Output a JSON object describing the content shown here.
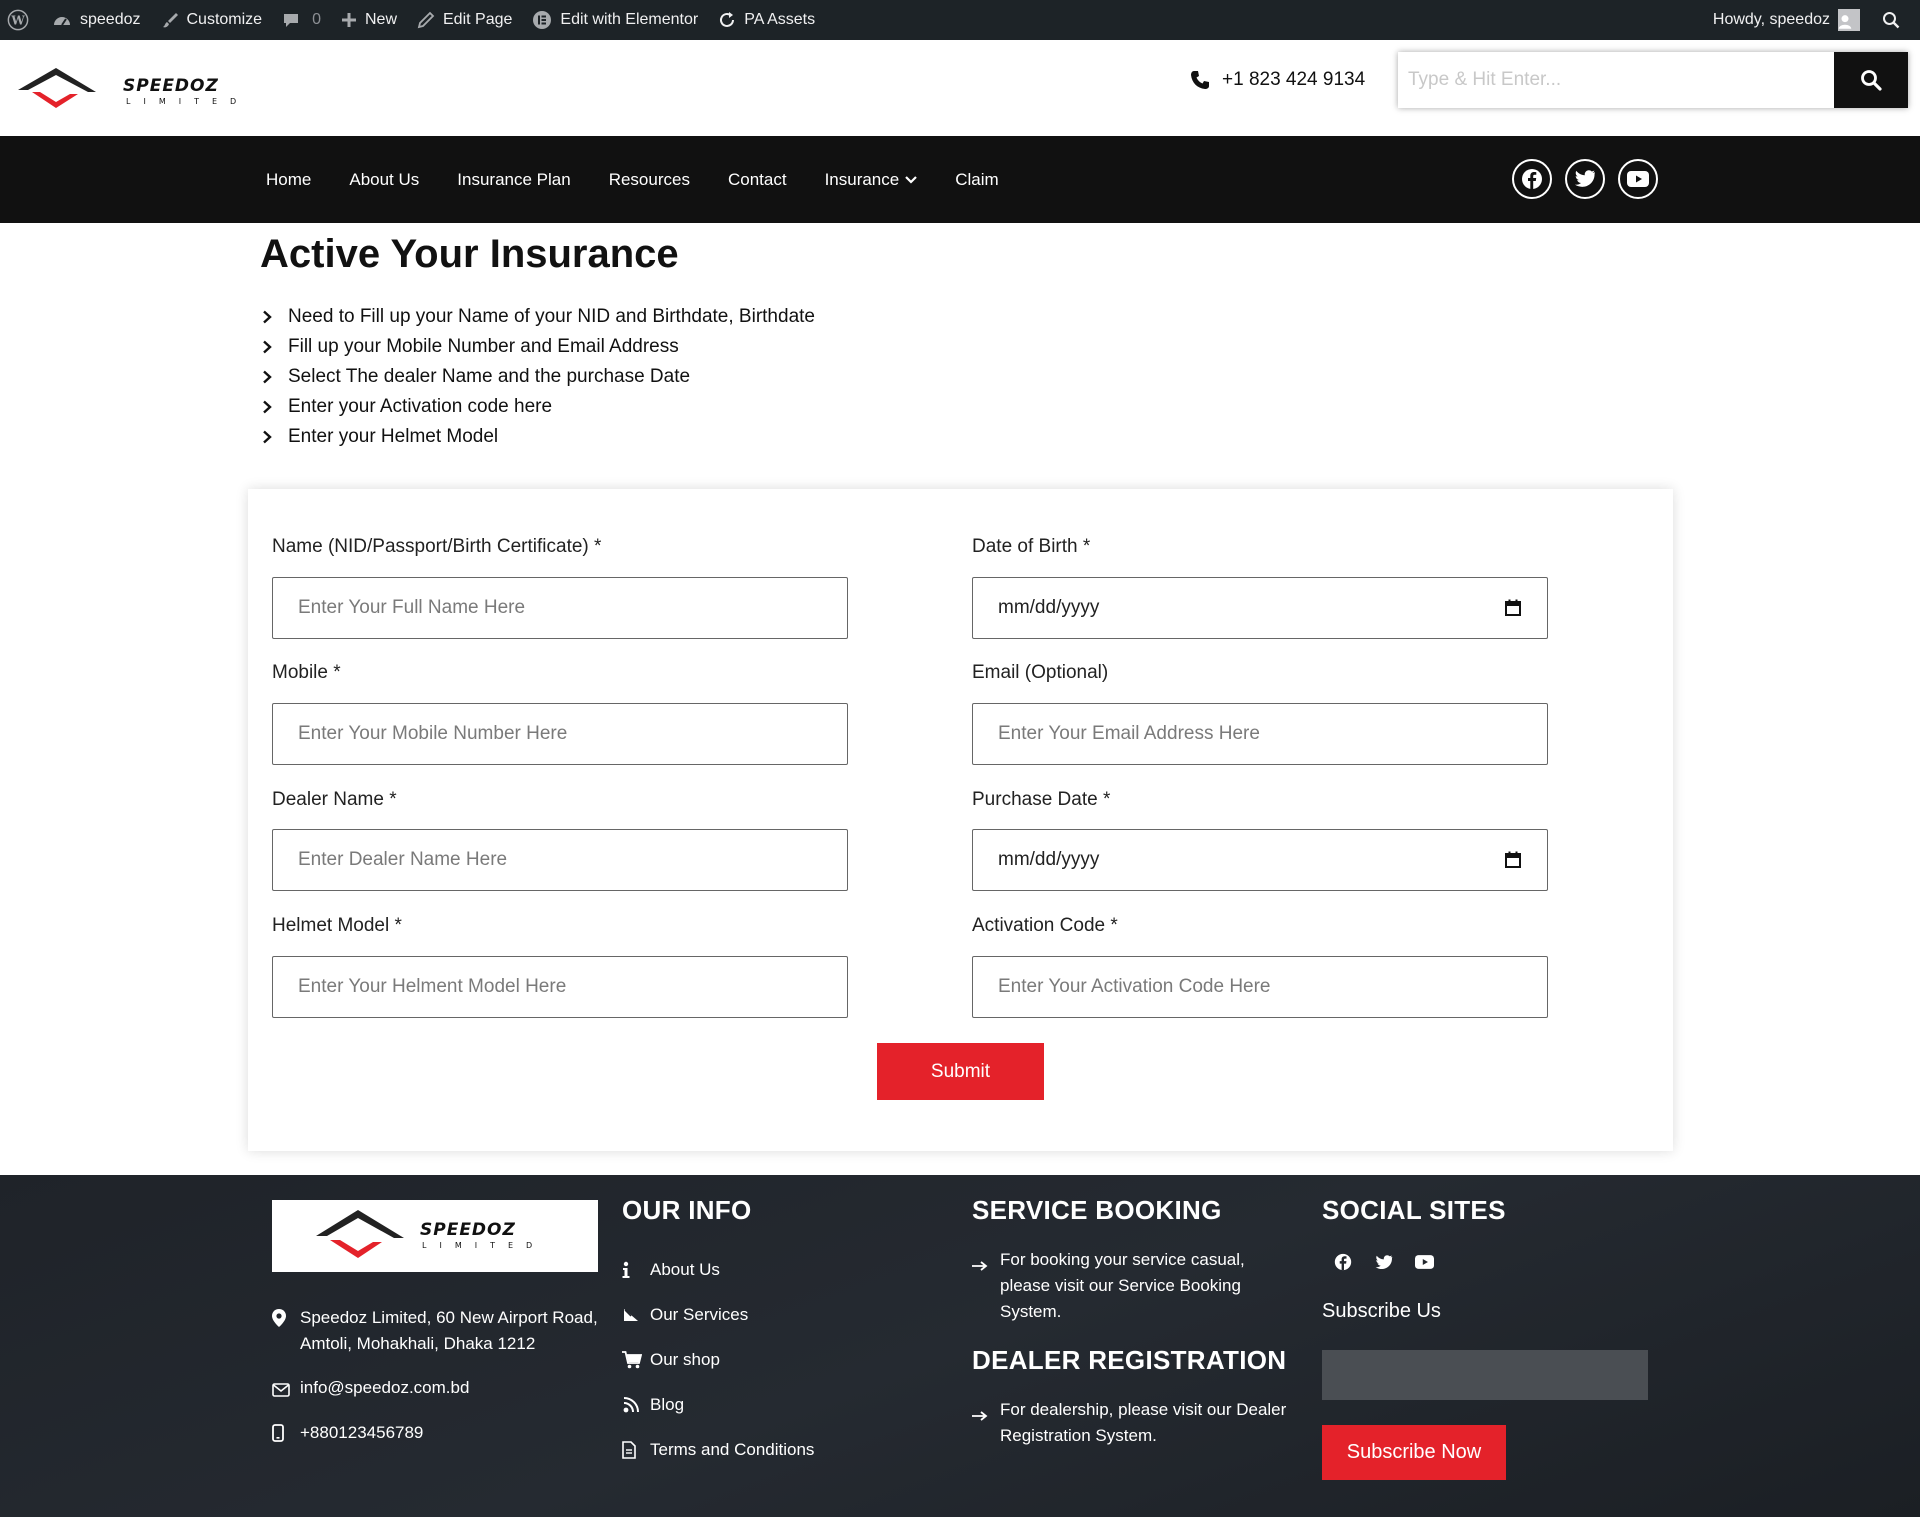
{
  "adminbar": {
    "site_name": "speedoz",
    "customize": "Customize",
    "comments_count": "0",
    "new": "New",
    "edit_page": "Edit Page",
    "edit_elementor": "Edit with Elementor",
    "pa_assets": "PA Assets",
    "howdy": "Howdy, speedoz"
  },
  "header": {
    "phone": "+1 823 424 9134",
    "search_placeholder": "Type & Hit Enter..."
  },
  "nav": {
    "items": [
      "Home",
      "About Us",
      "Insurance Plan",
      "Resources",
      "Contact",
      "Insurance",
      "Claim"
    ]
  },
  "main": {
    "title": "Active Your Insurance",
    "instructions": [
      "Need to Fill up your Name of your NID and Birthdate, Birthdate",
      "Fill up your Mobile Number and Email Address",
      "Select The dealer Name and the purchase Date",
      "Enter your Activation code here",
      "Enter your Helmet Model"
    ]
  },
  "form": {
    "name_label": "Name (NID/Passport/Birth Certificate) *",
    "name_placeholder": "Enter Your Full Name Here",
    "dob_label": "Date of Birth *",
    "dob_value": "mm/dd/yyyy",
    "mobile_label": "Mobile *",
    "mobile_placeholder": "Enter Your Mobile Number Here",
    "email_label": "Email (Optional)",
    "email_placeholder": "Enter Your Email Address Here",
    "dealer_label": "Dealer Name *",
    "dealer_placeholder": "Enter Dealer Name Here",
    "purchase_label": "Purchase Date *",
    "purchase_value": "mm/dd/yyyy",
    "helmet_label": "Helmet Model *",
    "helmet_placeholder": "Enter Your Helment Model Here",
    "activation_label": "Activation Code *",
    "activation_placeholder": "Enter Your Activation Code Here",
    "submit": "Submit"
  },
  "footer": {
    "address": "Speedoz Limited, 60 New Airport Road, Amtoli, Mohakhali, Dhaka 1212",
    "email": "info@speedoz.com.bd",
    "phone": "+880123456789",
    "our_info_heading": "OUR INFO",
    "links": [
      "About Us",
      "Our Services",
      "Our shop",
      "Blog",
      "Terms and Conditions"
    ],
    "service_heading": "SERVICE BOOKING",
    "service_text": "For booking your service casual, please visit our Service Booking System.",
    "dealer_heading": "DEALER REGISTRATION",
    "dealer_text": "For dealership, please visit our Dealer Registration System.",
    "social_heading": "SOCIAL SITES",
    "subscribe_label": "Subscribe Us",
    "subscribe_button": "Subscribe Now"
  },
  "brand": {
    "logo_text": "SPEEDOZ",
    "logo_subtext": "LIMITED",
    "accent_color": "#e4222a",
    "nav_bg": "#111111",
    "footer_bg": "#22262c"
  }
}
